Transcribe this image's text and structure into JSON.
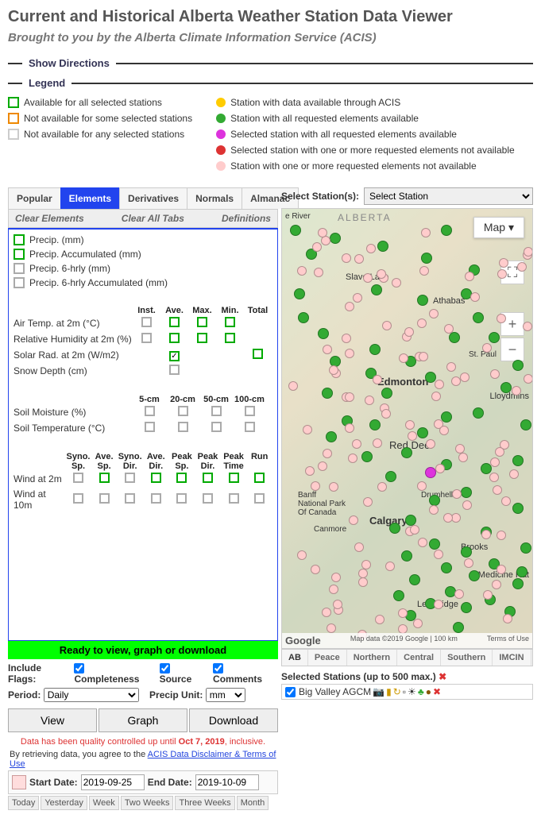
{
  "title": "Current and Historical Alberta Weather Station Data Viewer",
  "subtitle": "Brought to you by the Alberta Climate Information Service (ACIS)",
  "show_directions": "Show Directions",
  "legend_label": "Legend",
  "legend_left": [
    "Available for all selected stations",
    "Not available for some selected stations",
    "Not available for any selected stations"
  ],
  "legend_right": [
    "Station with data available through ACIS",
    "Station with all requested elements available",
    "Selected station with all requested elements available",
    "Selected station with one or more requested elements not available",
    "Station with one or more requested elements not available"
  ],
  "tabs": [
    "Popular",
    "Elements",
    "Derivatives",
    "Normals",
    "Almanac"
  ],
  "tab_links": [
    "Clear Elements",
    "Clear All Tabs",
    "Definitions"
  ],
  "precip_items": [
    {
      "label": "Precip. (mm)",
      "color": "green"
    },
    {
      "label": "Precip. Accumulated (mm)",
      "color": "green"
    },
    {
      "label": "Precip. 6-hrly (mm)",
      "color": "gray"
    },
    {
      "label": "Precip. 6-hrly Accumulated (mm)",
      "color": "gray"
    }
  ],
  "grid1_headers": [
    "Inst.",
    "Ave.",
    "Max.",
    "Min.",
    "Total"
  ],
  "grid1_rows": [
    {
      "label": "Air Temp. at 2m (°C)",
      "cells": [
        "gray",
        "green",
        "green",
        "green",
        ""
      ]
    },
    {
      "label": "Relative Humidity at 2m (%)",
      "cells": [
        "gray",
        "green",
        "green",
        "green",
        ""
      ]
    },
    {
      "label": "Solar Rad. at 2m (W/m2)",
      "cells": [
        "",
        "checked",
        "",
        "",
        "green"
      ]
    },
    {
      "label": "Snow Depth (cm)",
      "cells": [
        "",
        "gray",
        "",
        "",
        ""
      ]
    }
  ],
  "soil_headers": [
    "5-cm",
    "20-cm",
    "50-cm",
    "100-cm"
  ],
  "soil_rows": [
    {
      "label": "Soil Moisture (%)",
      "cells": [
        "gray",
        "gray",
        "gray",
        "gray"
      ]
    },
    {
      "label": "Soil Temperature (°C)",
      "cells": [
        "gray",
        "gray",
        "gray",
        "gray"
      ]
    }
  ],
  "wind_headers": [
    "Syno. Sp.",
    "Ave. Sp.",
    "Syno. Dir.",
    "Ave. Dir.",
    "Peak Sp.",
    "Peak Dir.",
    "Peak Time",
    "Run"
  ],
  "wind_rows": [
    {
      "label": "Wind at 2m",
      "cells": [
        "gray",
        "green",
        "gray",
        "green",
        "green",
        "green",
        "green",
        "green"
      ]
    },
    {
      "label": "Wind at 10m",
      "cells": [
        "gray",
        "gray",
        "gray",
        "gray",
        "gray",
        "gray",
        "gray",
        "gray"
      ]
    }
  ],
  "ready_bar": "Ready to view, graph or download",
  "flags_label": "Include Flags:",
  "flags": [
    "Completeness",
    "Source",
    "Comments"
  ],
  "period_label": "Period:",
  "period_value": "Daily",
  "precip_unit_label": "Precip Unit:",
  "precip_unit_value": "mm",
  "buttons": [
    "View",
    "Graph",
    "Download"
  ],
  "qc_note_pre": "Data has been quality controlled up until ",
  "qc_note_date": "Oct 7, 2019",
  "qc_note_post": ", inclusive.",
  "disclaimer_pre": "By retrieving data, you agree to the ",
  "disclaimer_link": "ACIS Data Disclaimer & Terms of Use",
  "start_date_label": "Start Date:",
  "start_date": "2019-09-25",
  "end_date_label": "End Date:",
  "end_date": "2019-10-09",
  "quick_dates": [
    "Today",
    "Yesterday",
    "Week",
    "Two Weeks",
    "Three Weeks",
    "Month"
  ],
  "select_station_label": "Select Station(s):",
  "select_station_placeholder": "Select Station",
  "map_type": "Map",
  "map_province": "ALBERTA",
  "map_cities": {
    "edmonton": "Edmonton",
    "reddeer": "Red Deer",
    "calgary": "Calgary",
    "lloyd": "Lloydmins",
    "medhat": "Medicine Hat",
    "lethbridge": "Lethbridge",
    "slave": "Slave Lake",
    "athabas": "Athabas",
    "drumheller": "Drumheller",
    "brooks": "Brooks",
    "banff": "Banff National Park Of Canada",
    "canmore": "Canmore",
    "river": "e River",
    "stpaul": "St. Paul"
  },
  "map_credit_left": "Google",
  "map_credit_mid": "Map data ©2019 Google  |  100 km",
  "map_credit_right": "Terms of Use",
  "map_tabs": [
    "AB",
    "Peace",
    "Northern",
    "Central",
    "Southern",
    "IMCIN"
  ],
  "selected_stations_label": "Selected Stations (up to 500 max.)",
  "selected_station": "Big Valley AGCM"
}
